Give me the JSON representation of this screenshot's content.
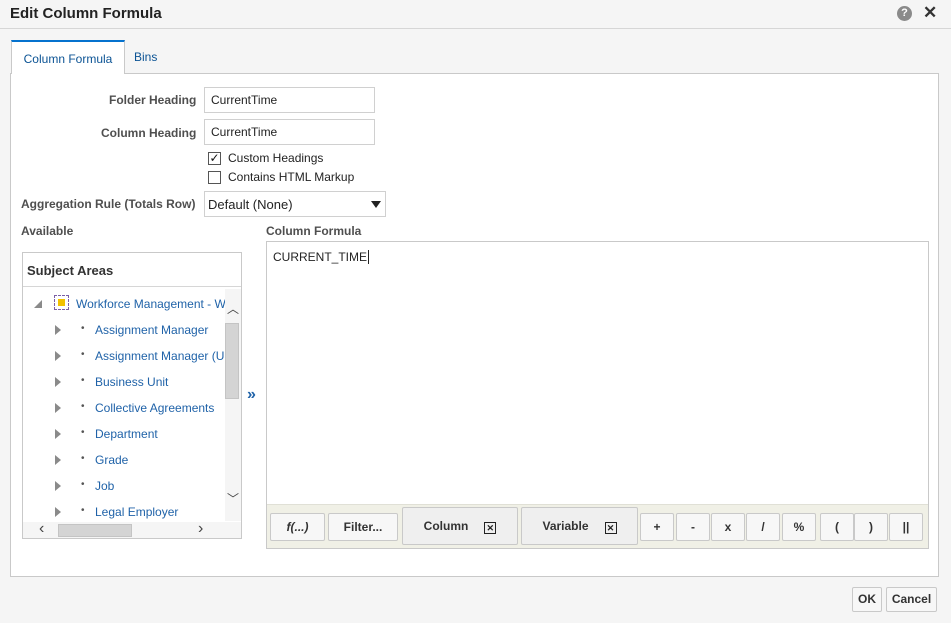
{
  "dialog": {
    "title": "Edit Column Formula",
    "help_icon": "?",
    "close_icon": "✕"
  },
  "tabs": [
    {
      "label": "Column Formula",
      "active": true
    },
    {
      "label": "Bins",
      "active": false
    }
  ],
  "form": {
    "folder_heading_label": "Folder Heading",
    "folder_heading_value": "CurrentTime",
    "column_heading_label": "Column Heading",
    "column_heading_value": "CurrentTime",
    "custom_headings_label": "Custom Headings",
    "custom_headings_checked": true,
    "contains_html_label": "Contains HTML Markup",
    "contains_html_checked": false,
    "aggregation_label": "Aggregation Rule (Totals Row)",
    "aggregation_value": "Default (None)"
  },
  "available": {
    "label": "Available",
    "subject_areas_title": "Subject Areas",
    "root": "Workforce Management - W",
    "items": [
      {
        "label": "Assignment Manager"
      },
      {
        "label": "Assignment Manager (U"
      },
      {
        "label": "Business Unit"
      },
      {
        "label": "Collective Agreements"
      },
      {
        "label": "Department"
      },
      {
        "label": "Grade"
      },
      {
        "label": "Job"
      },
      {
        "label": "Legal Employer"
      }
    ]
  },
  "formula": {
    "label": "Column Formula",
    "text": "CURRENT_TIME",
    "buttons": {
      "function": "f(...)",
      "filter": "Filter...",
      "column": "Column",
      "variable": "Variable",
      "operators": [
        "+",
        "-",
        "x",
        "/",
        "%",
        "(",
        ")",
        "||"
      ]
    }
  },
  "footer": {
    "ok": "OK",
    "cancel": "Cancel"
  },
  "colors": {
    "accent": "#0572ce",
    "link": "#1f62a8",
    "toolbar_bg": "#f0f0e6"
  }
}
